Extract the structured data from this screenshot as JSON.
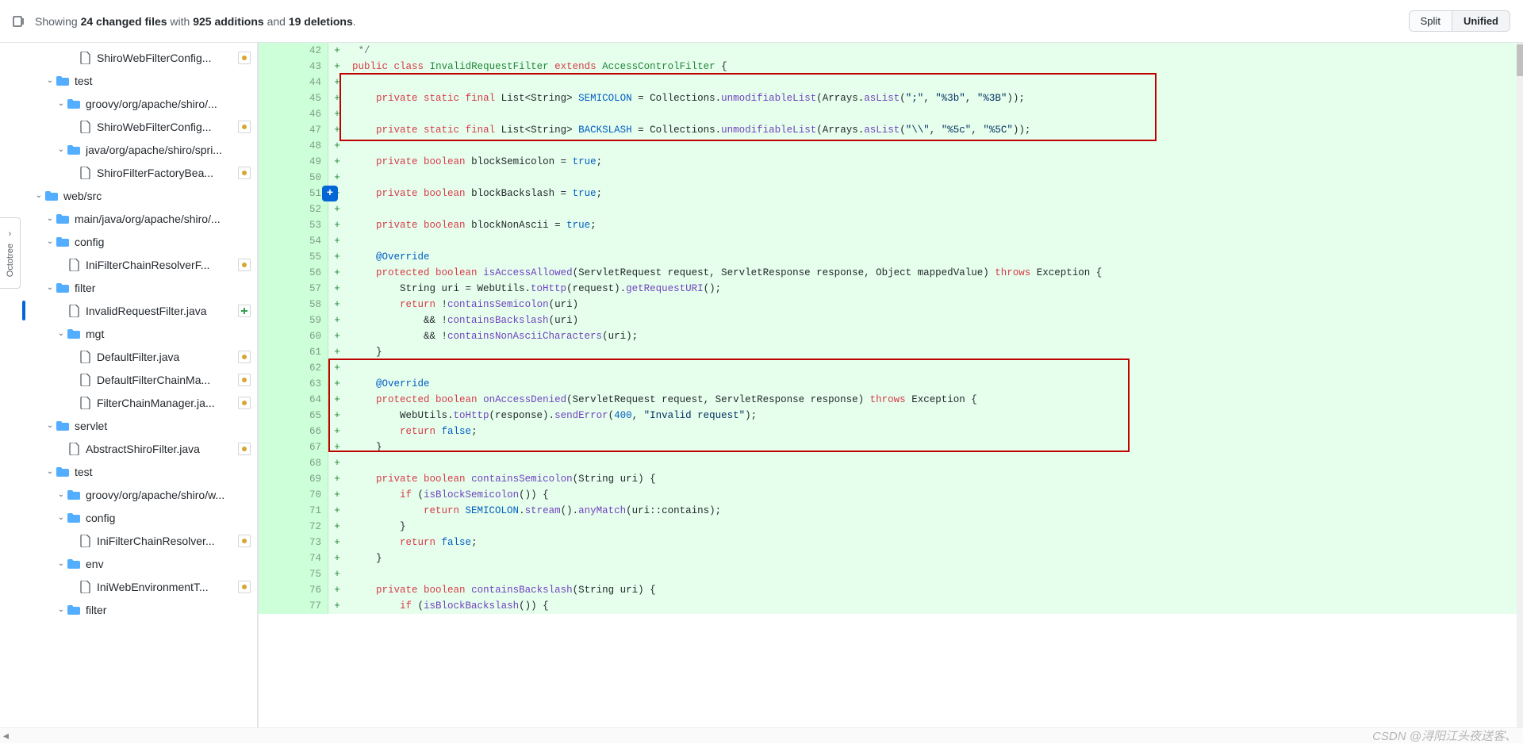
{
  "header": {
    "showing": "Showing",
    "files_count": "24 changed files",
    "with": "with",
    "additions": "925 additions",
    "and": "and",
    "deletions": "19 deletions",
    "period": ".",
    "split_label": "Split",
    "unified_label": "Unified"
  },
  "octotree": {
    "label": "Octotree"
  },
  "tree": [
    {
      "id": "t0",
      "type": "file",
      "depth": 4,
      "label": "ShiroWebFilterConfig...",
      "status": "mod"
    },
    {
      "id": "t1",
      "type": "folder",
      "depth": 2,
      "label": "test",
      "open": true
    },
    {
      "id": "t2",
      "type": "folder",
      "depth": 3,
      "label": "groovy/org/apache/shiro/...",
      "open": true
    },
    {
      "id": "t3",
      "type": "file",
      "depth": 4,
      "label": "ShiroWebFilterConfig...",
      "status": "mod"
    },
    {
      "id": "t4",
      "type": "folder",
      "depth": 3,
      "label": "java/org/apache/shiro/spri...",
      "open": true
    },
    {
      "id": "t5",
      "type": "file",
      "depth": 4,
      "label": "ShiroFilterFactoryBea...",
      "status": "mod"
    },
    {
      "id": "t6",
      "type": "folder",
      "depth": 1,
      "label": "web/src",
      "open": true
    },
    {
      "id": "t7",
      "type": "folder",
      "depth": 2,
      "label": "main/java/org/apache/shiro/...",
      "open": true
    },
    {
      "id": "t8",
      "type": "folder",
      "depth": 2,
      "label": "config",
      "open": true
    },
    {
      "id": "t9",
      "type": "file",
      "depth": 3,
      "label": "IniFilterChainResolverF...",
      "status": "mod"
    },
    {
      "id": "t10",
      "type": "folder",
      "depth": 2,
      "label": "filter",
      "open": true
    },
    {
      "id": "t11",
      "type": "file",
      "depth": 3,
      "label": "InvalidRequestFilter.java",
      "status": "add",
      "selected": true
    },
    {
      "id": "t12",
      "type": "folder",
      "depth": 3,
      "label": "mgt",
      "open": true
    },
    {
      "id": "t13",
      "type": "file",
      "depth": 4,
      "label": "DefaultFilter.java",
      "status": "mod"
    },
    {
      "id": "t14",
      "type": "file",
      "depth": 4,
      "label": "DefaultFilterChainMa...",
      "status": "mod"
    },
    {
      "id": "t15",
      "type": "file",
      "depth": 4,
      "label": "FilterChainManager.ja...",
      "status": "mod"
    },
    {
      "id": "t16",
      "type": "folder",
      "depth": 2,
      "label": "servlet",
      "open": true
    },
    {
      "id": "t17",
      "type": "file",
      "depth": 3,
      "label": "AbstractShiroFilter.java",
      "status": "mod"
    },
    {
      "id": "t18",
      "type": "folder",
      "depth": 2,
      "label": "test",
      "open": true
    },
    {
      "id": "t19",
      "type": "folder",
      "depth": 3,
      "label": "groovy/org/apache/shiro/w...",
      "open": true
    },
    {
      "id": "t20",
      "type": "folder",
      "depth": 3,
      "label": "config",
      "open": true
    },
    {
      "id": "t21",
      "type": "file",
      "depth": 4,
      "label": "IniFilterChainResolver...",
      "status": "mod"
    },
    {
      "id": "t22",
      "type": "folder",
      "depth": 3,
      "label": "env",
      "open": true
    },
    {
      "id": "t23",
      "type": "file",
      "depth": 4,
      "label": "IniWebEnvironmentT...",
      "status": "mod"
    },
    {
      "id": "t24",
      "type": "folder",
      "depth": 3,
      "label": "filter",
      "open": true
    }
  ],
  "lines": [
    {
      "n": 42,
      "html": " <span class='tok-c'>*/</span>"
    },
    {
      "n": 43,
      "html": "<span class='tok-k'>public</span> <span class='tok-k'>class</span> <span class='tok-t'>InvalidRequestFilter</span> <span class='tok-k'>extends</span> <span class='tok-t'>AccessControlFilter</span> {"
    },
    {
      "n": 44,
      "html": ""
    },
    {
      "n": 45,
      "html": "    <span class='tok-k'>private</span> <span class='tok-k'>static</span> <span class='tok-k'>final</span> List&lt;String&gt; <span class='tok-cn'>SEMICOLON</span> = Collections.<span class='tok-m'>unmodifiableList</span>(Arrays.<span class='tok-m'>asList</span>(<span class='tok-s'>\";\"</span>, <span class='tok-s'>\"%3b\"</span>, <span class='tok-s'>\"%3B\"</span>));"
    },
    {
      "n": 46,
      "html": ""
    },
    {
      "n": 47,
      "html": "    <span class='tok-k'>private</span> <span class='tok-k'>static</span> <span class='tok-k'>final</span> List&lt;String&gt; <span class='tok-cn'>BACKSLASH</span> = Collections.<span class='tok-m'>unmodifiableList</span>(Arrays.<span class='tok-m'>asList</span>(<span class='tok-s'>\"\\\\\"</span>, <span class='tok-s'>\"%5c\"</span>, <span class='tok-s'>\"%5C\"</span>));"
    },
    {
      "n": 48,
      "html": ""
    },
    {
      "n": 49,
      "html": "    <span class='tok-k'>private</span> <span class='tok-k'>boolean</span> blockSemicolon = <span class='tok-cn'>true</span>;"
    },
    {
      "n": 50,
      "html": ""
    },
    {
      "n": 51,
      "html": "    <span class='tok-k'>private</span> <span class='tok-k'>boolean</span> blockBackslash = <span class='tok-cn'>true</span>;",
      "plus": true
    },
    {
      "n": 52,
      "html": ""
    },
    {
      "n": 53,
      "html": "    <span class='tok-k'>private</span> <span class='tok-k'>boolean</span> blockNonAscii = <span class='tok-cn'>true</span>;"
    },
    {
      "n": 54,
      "html": ""
    },
    {
      "n": 55,
      "html": "    <span class='tok-anno'>@Override</span>"
    },
    {
      "n": 56,
      "html": "    <span class='tok-k'>protected</span> <span class='tok-k'>boolean</span> <span class='tok-m'>isAccessAllowed</span>(ServletRequest request, ServletResponse response, Object mappedValue) <span class='tok-k'>throws</span> Exception {"
    },
    {
      "n": 57,
      "html": "        String uri = WebUtils.<span class='tok-m'>toHttp</span>(request).<span class='tok-m'>getRequestURI</span>();"
    },
    {
      "n": 58,
      "html": "        <span class='tok-k'>return</span> !<span class='tok-m'>containsSemicolon</span>(uri)"
    },
    {
      "n": 59,
      "html": "            &amp;&amp; !<span class='tok-m'>containsBackslash</span>(uri)"
    },
    {
      "n": 60,
      "html": "            &amp;&amp; !<span class='tok-m'>containsNonAsciiCharacters</span>(uri);"
    },
    {
      "n": 61,
      "html": "    }"
    },
    {
      "n": 62,
      "html": ""
    },
    {
      "n": 63,
      "html": "    <span class='tok-anno'>@Override</span>"
    },
    {
      "n": 64,
      "html": "    <span class='tok-k'>protected</span> <span class='tok-k'>boolean</span> <span class='tok-m'>onAccessDenied</span>(ServletRequest request, ServletResponse response) <span class='tok-k'>throws</span> Exception {"
    },
    {
      "n": 65,
      "html": "        WebUtils.<span class='tok-m'>toHttp</span>(response).<span class='tok-m'>sendError</span>(<span class='tok-cn'>400</span>, <span class='tok-s'>\"Invalid request\"</span>);"
    },
    {
      "n": 66,
      "html": "        <span class='tok-k'>return</span> <span class='tok-cn'>false</span>;"
    },
    {
      "n": 67,
      "html": "    }"
    },
    {
      "n": 68,
      "html": ""
    },
    {
      "n": 69,
      "html": "    <span class='tok-k'>private</span> <span class='tok-k'>boolean</span> <span class='tok-m'>containsSemicolon</span>(String uri) {"
    },
    {
      "n": 70,
      "html": "        <span class='tok-k'>if</span> (<span class='tok-m'>isBlockSemicolon</span>()) {"
    },
    {
      "n": 71,
      "html": "            <span class='tok-k'>return</span> <span class='tok-cn'>SEMICOLON</span>.<span class='tok-m'>stream</span>().<span class='tok-m'>anyMatch</span>(uri::contains);"
    },
    {
      "n": 72,
      "html": "        }"
    },
    {
      "n": 73,
      "html": "        <span class='tok-k'>return</span> <span class='tok-cn'>false</span>;"
    },
    {
      "n": 74,
      "html": "    }"
    },
    {
      "n": 75,
      "html": ""
    },
    {
      "n": 76,
      "html": "    <span class='tok-k'>private</span> <span class='tok-k'>boolean</span> <span class='tok-m'>containsBackslash</span>(String uri) {"
    },
    {
      "n": 77,
      "html": "        <span class='tok-k'>if</span> (<span class='tok-m'>isBlockBackslash</span>()) {"
    }
  ],
  "footer": {
    "watermark": "CSDN @浔阳江头夜送客、"
  }
}
